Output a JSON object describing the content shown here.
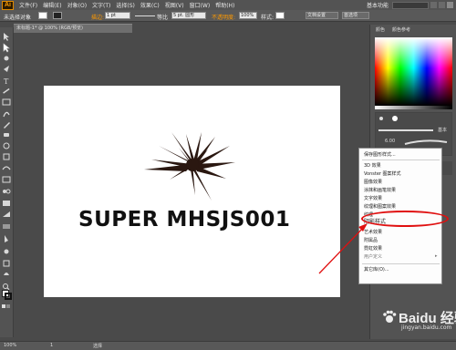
{
  "app": {
    "logo": "Ai",
    "menus": [
      "文件(F)",
      "编辑(E)",
      "对象(O)",
      "文字(T)",
      "选择(S)",
      "效果(C)",
      "视图(V)",
      "窗口(W)",
      "帮助(H)"
    ],
    "workspace": "基本功能"
  },
  "control_bar": {
    "selection_label": "未选择对象",
    "stroke_label": "描边:",
    "stroke_weight": "1 pt",
    "brush_label": "等比",
    "brush_size": "5 pt. 圆形",
    "opacity_label": "不透明度:",
    "opacity_value": "100%",
    "style_label": "样式:",
    "doc_settings_label": "文档设置",
    "prefs_label": "首选项"
  },
  "document": {
    "tab_title": "未标题-1* @ 100% (RGB/预览)"
  },
  "canvas": {
    "headline": "SUPER MHSJS001"
  },
  "panels": {
    "color_tabs": [
      "颜色",
      "颜色参考"
    ],
    "brush_label": "基本",
    "brush_size": "6.00"
  },
  "context_menu": {
    "items": [
      "保存图形样式...",
      "3D 效果",
      "Vonster 图案样式",
      "图像效果",
      "涂抹和画笔效果",
      "文字效果",
      "纹理和图案效果",
      "纹理",
      "阴影样式",
      "艺术效果",
      "附属品",
      "霓虹效果",
      "用户定义",
      "其它库(O)..."
    ],
    "highlighted_item": "阴影样式"
  },
  "status_bar": {
    "zoom": "100%",
    "page": "1",
    "tool": "选择"
  },
  "watermark": {
    "brand": "Baidu 经验",
    "url": "jingyan.baidu.com"
  },
  "colors": {
    "highlight_red": "#e01010",
    "ui_dark": "#535353",
    "canvas_bg": "#4a4a4a"
  }
}
